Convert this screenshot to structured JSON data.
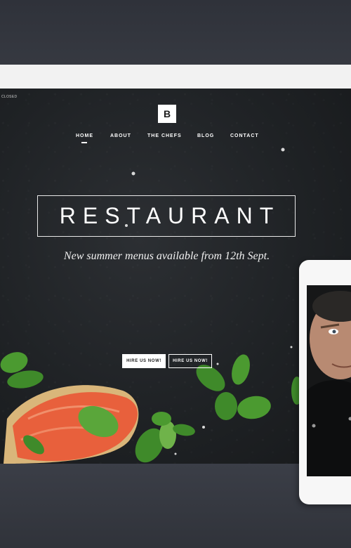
{
  "hero": {
    "closed_tag": "CLOSED",
    "logo_letter": "B",
    "nav": [
      {
        "label": "HOME",
        "active": true
      },
      {
        "label": "ABOUT",
        "active": false
      },
      {
        "label": "THE CHEFS",
        "active": false
      },
      {
        "label": "BLOG",
        "active": false
      },
      {
        "label": "CONTACT",
        "active": false
      }
    ],
    "title": "RESTAURANT",
    "subtitle": "New summer menus available from 12th Sept.",
    "buttons": {
      "primary": "HIRE US NOW!",
      "secondary": "HIRE US NOW!"
    }
  },
  "colors": {
    "background": "#3a3d45",
    "hero_dark": "#1f2225",
    "salmon": "#e8603c",
    "basil": "#3f8a2a",
    "white": "#ffffff"
  }
}
